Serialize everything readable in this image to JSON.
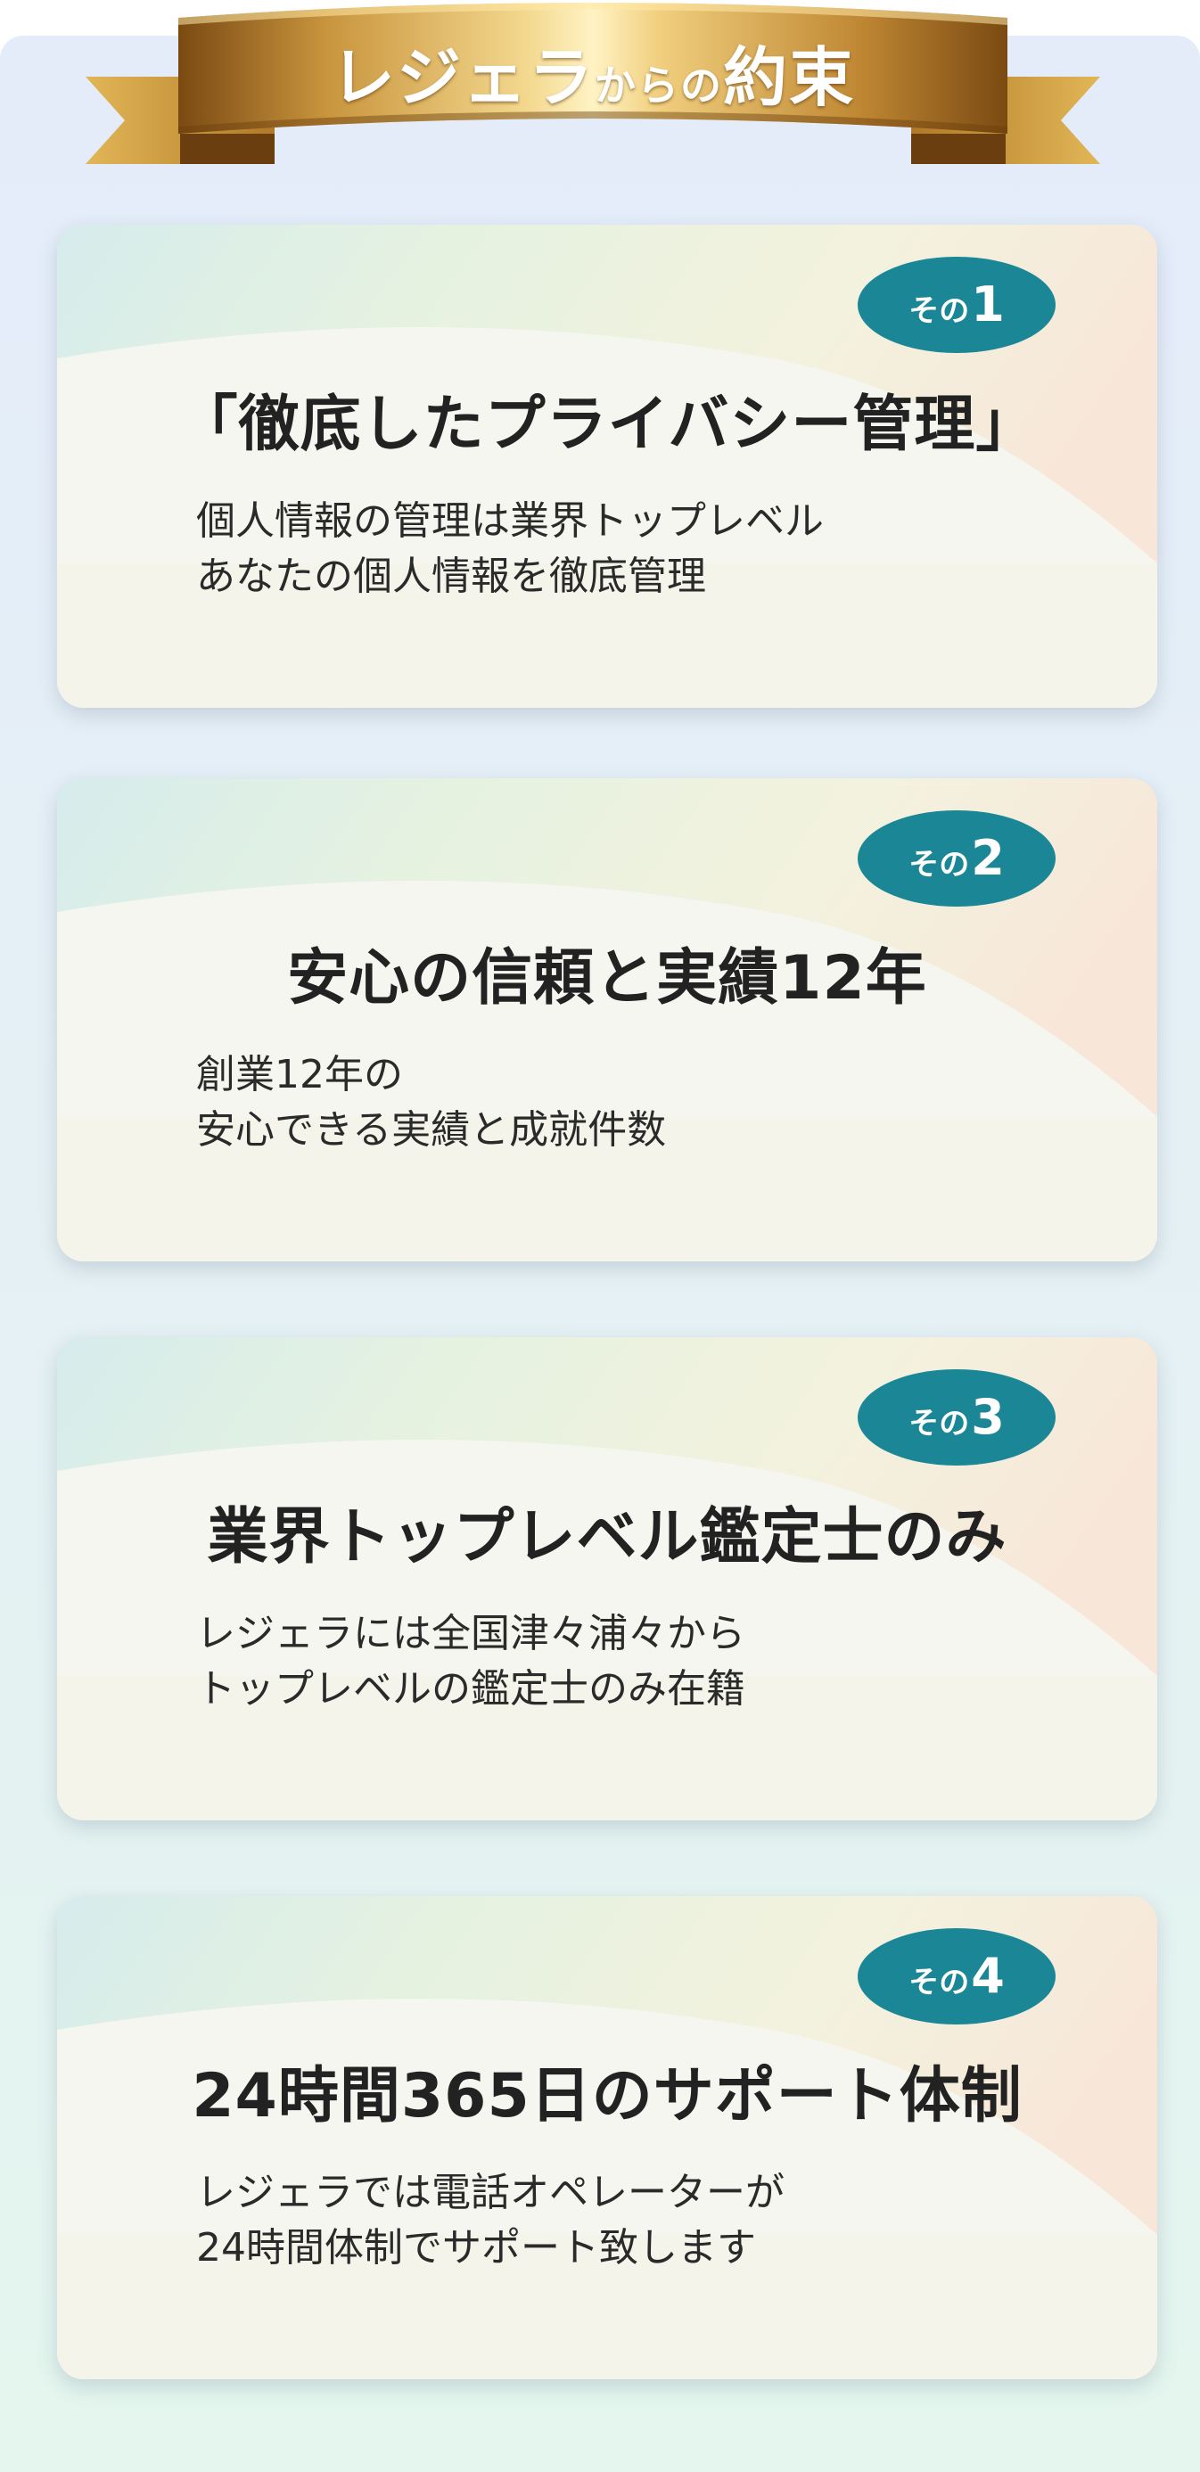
{
  "banner": {
    "title_part1": "レジェラ",
    "title_part2": "からの",
    "title_part3": "約束"
  },
  "colors": {
    "badge": "#1b8796",
    "ribbon_gold": "#b27a2a",
    "panel_top": "#e4ecfa",
    "panel_bottom": "#e4f6ee"
  },
  "promises": [
    {
      "badge_prefix": "その",
      "badge_number": "1",
      "title": "「徹底したプライバシー管理」",
      "line1": "個人情報の管理は業界トップレベル",
      "line2": "あなたの個人情報を徹底管理"
    },
    {
      "badge_prefix": "その",
      "badge_number": "2",
      "title": "安心の信頼と実績12年",
      "line1": "創業12年の",
      "line2": "安心できる実績と成就件数"
    },
    {
      "badge_prefix": "その",
      "badge_number": "3",
      "title": "業界トップレベル鑑定士のみ",
      "line1": "レジェラには全国津々浦々から",
      "line2": "トップレベルの鑑定士のみ在籍"
    },
    {
      "badge_prefix": "その",
      "badge_number": "4",
      "title": "24時間365日のサポート体制",
      "line1": "レジェラでは電話オペレーターが",
      "line2": "24時間体制でサポート致します"
    }
  ]
}
